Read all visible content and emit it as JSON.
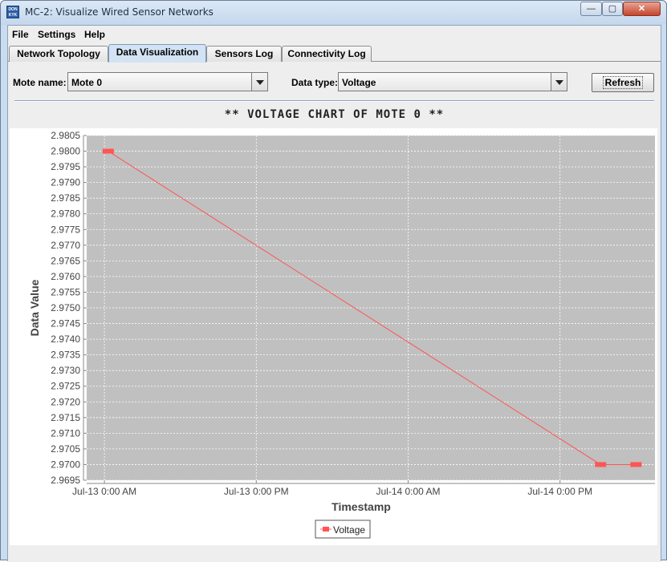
{
  "window": {
    "title": "MC-2: Visualize Wired Sensor Networks",
    "icon_text": "DON\nKYK",
    "controls": {
      "minimize": "—",
      "maximize": "▢",
      "close": "✕"
    }
  },
  "menu": {
    "file": "File",
    "settings": "Settings",
    "help": "Help"
  },
  "tabs": [
    {
      "label": "Network Topology",
      "active": false
    },
    {
      "label": "Data Visualization",
      "active": true
    },
    {
      "label": "Sensors Log",
      "active": false
    },
    {
      "label": "Connectivity Log",
      "active": false
    }
  ],
  "controls": {
    "mote_label": "Mote name:",
    "mote_value": "Mote 0",
    "type_label": "Data type:",
    "type_value": "Voltage",
    "refresh_label": "Refresh"
  },
  "chart_title": "** VOLTAGE CHART OF MOTE 0 **",
  "colors": {
    "plot_bg": "#c0c0c0",
    "series": "#ff5555",
    "grid": "#ffffff"
  },
  "chart_data": {
    "type": "line",
    "title": "** VOLTAGE CHART OF MOTE 0 **",
    "xlabel": "Timestamp",
    "ylabel": "Data Value",
    "ylim": [
      2.9695,
      2.9805
    ],
    "y_ticks": [
      "2.9695",
      "2.9700",
      "2.9705",
      "2.9710",
      "2.9715",
      "2.9720",
      "2.9725",
      "2.9730",
      "2.9735",
      "2.9740",
      "2.9745",
      "2.9750",
      "2.9755",
      "2.9760",
      "2.9765",
      "2.9770",
      "2.9775",
      "2.9780",
      "2.9785",
      "2.9790",
      "2.9795",
      "2.9800",
      "2.9805"
    ],
    "x_ticks": [
      "Jul-13 0:00 AM",
      "Jul-13 0:00 PM",
      "Jul-14 0:00 AM",
      "Jul-14 0:00 PM"
    ],
    "x_tick_hours": [
      0,
      12,
      24,
      36
    ],
    "xlim_hours": [
      -1.4,
      43.5
    ],
    "grid": true,
    "legend_position": "bottom-center",
    "series": [
      {
        "name": "Voltage",
        "points": [
          {
            "x_hours": 0.3,
            "y": 2.98
          },
          {
            "x_hours": 39.2,
            "y": 2.97
          },
          {
            "x_hours": 42.0,
            "y": 2.97
          }
        ]
      }
    ]
  }
}
